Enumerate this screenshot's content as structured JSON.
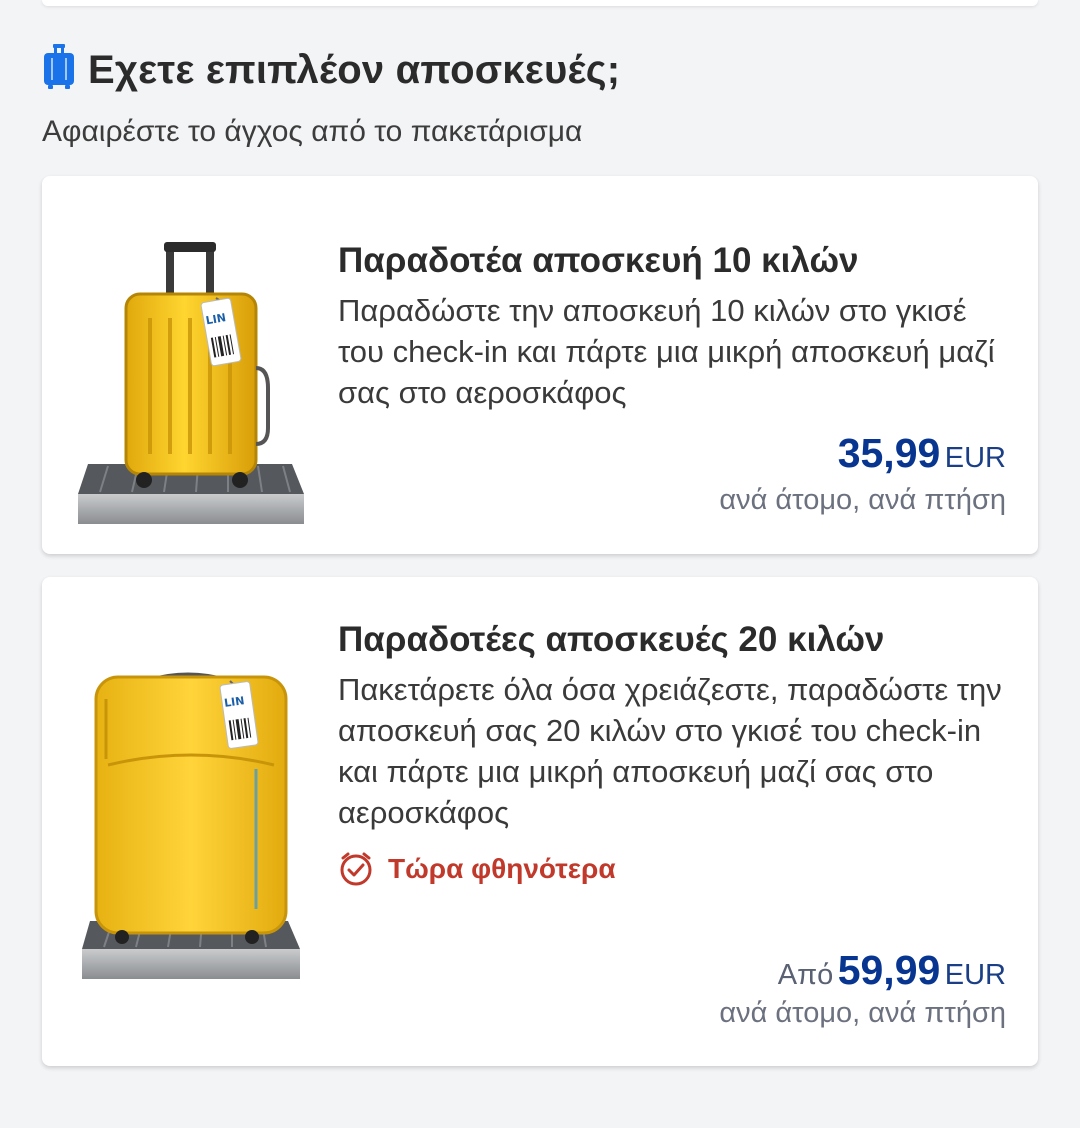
{
  "header": {
    "title": "Εχετε επιπλέον αποσκευές;",
    "subtitle": "Αφαιρέστε το άγχος από το πακετάρισμα",
    "icon": "luggage-icon",
    "icon_color": "#1a73e8"
  },
  "offers": [
    {
      "title": "Παραδοτέα αποσκευή 10 κιλών",
      "description": "Παραδώστε την αποσκευή 10 κιλών στο γκισέ του check-in και πάρτε μια μικρή αποσκευή μαζί σας στο αεροσκάφος",
      "price_prefix": "",
      "price": "35,99",
      "currency": "EUR",
      "price_note": "ανά άτομο, ανά πτήση",
      "image": "yellow-hard-suitcase-image",
      "tag_text": "LIN"
    },
    {
      "title": "Παραδοτέες αποσκευές 20 κιλών",
      "description": "Πακετάρετε όλα όσα χρειάζεστε, παραδώστε την αποσκευή σας 20 κιλών στο γκισέ του check-in και πάρτε μια μικρή αποσκευή μαζί σας στο αεροσκάφος",
      "promo_label": "Τώρα φθηνότερα",
      "promo_icon": "clock-icon",
      "price_prefix": "Από",
      "price": "59,99",
      "currency": "EUR",
      "price_note": "ανά άτομο, ανά πτήση",
      "image": "yellow-soft-suitcase-image",
      "tag_text": "LIN"
    }
  ],
  "colors": {
    "price": "#073590",
    "promo": "#c0392b",
    "suitcase": "#f2c218",
    "background": "#f3f4f6"
  }
}
